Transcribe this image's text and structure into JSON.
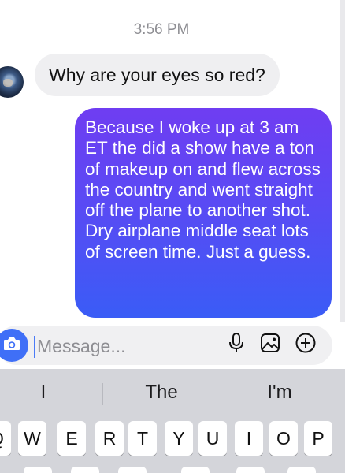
{
  "timestamp": "3:56 PM",
  "conversation": {
    "incoming_message": "Why are your eyes so red?",
    "outgoing_message": "Because I woke up at 3 am ET the did a show have a ton of makeup on and flew across the country and went straight off the plane to another shot. Dry airplane middle seat lots of screen time. Just a guess."
  },
  "composer": {
    "placeholder": "Message...",
    "icons": [
      "camera-icon",
      "microphone-icon",
      "image-icon",
      "plus-circle-icon"
    ],
    "accent_color": "#3f6ff7"
  },
  "keyboard": {
    "suggestions": [
      "I",
      "The",
      "I'm"
    ],
    "top_row": [
      "Q",
      "W",
      "E",
      "R",
      "T",
      "Y",
      "U",
      "I",
      "O",
      "P"
    ]
  },
  "colors": {
    "outgoing_gradient_top": "#6f3df2",
    "outgoing_gradient_bottom": "#3a5cf6",
    "incoming_bubble": "#efeff1",
    "keyboard_bg": "#d4d5da"
  }
}
